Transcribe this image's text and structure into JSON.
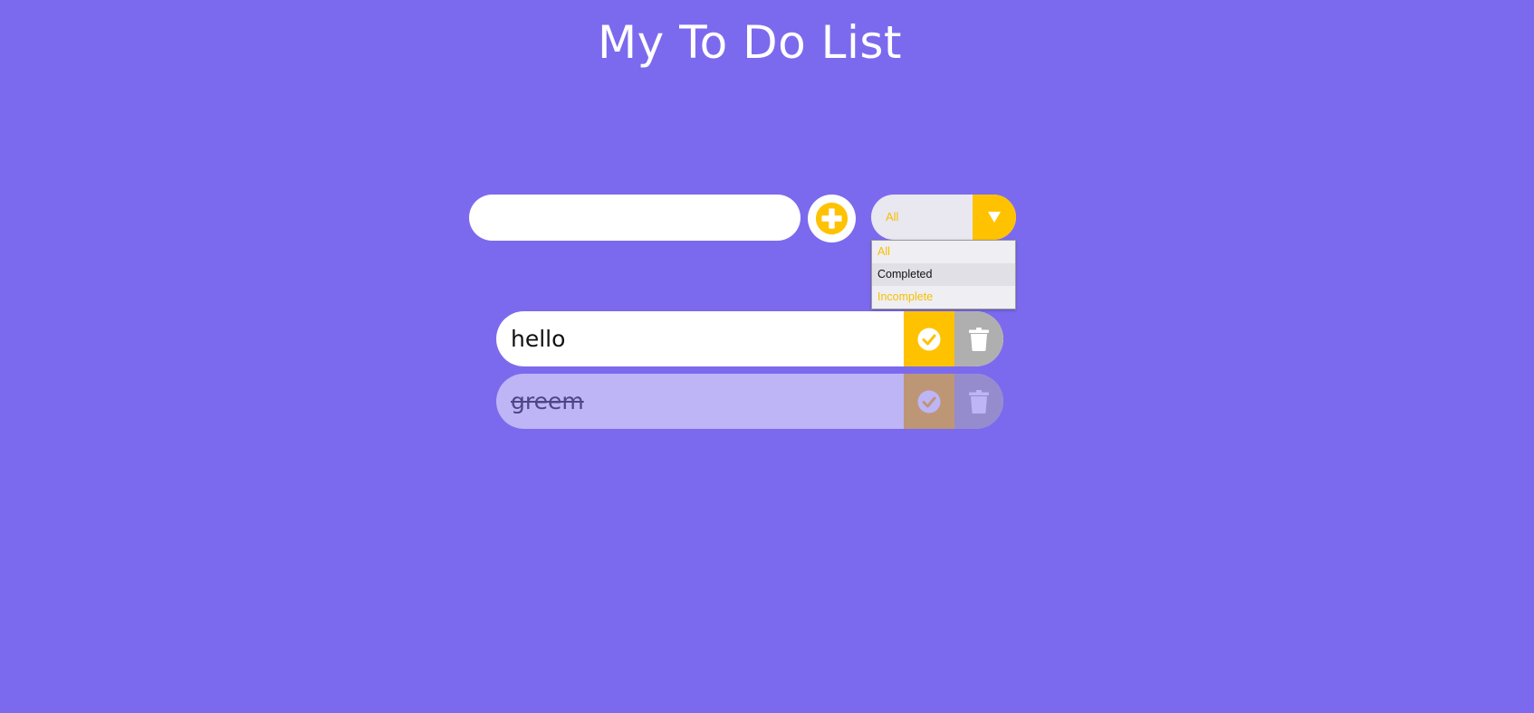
{
  "app": {
    "title": "My To Do List"
  },
  "form": {
    "input_value": "",
    "input_placeholder": ""
  },
  "filter": {
    "selected": "All",
    "options": [
      "All",
      "Completed",
      "Incomplete"
    ],
    "highlighted_option": "Completed"
  },
  "todos": [
    {
      "text": "hello",
      "completed": false
    },
    {
      "text": "greem",
      "completed": true
    }
  ],
  "icons": {
    "add": "plus-circle-icon",
    "dropdown": "caret-down-icon",
    "complete": "check-circle-icon",
    "delete": "trash-icon"
  },
  "colors": {
    "background": "#7b6aee",
    "accent": "#ffc200",
    "trash": "#afafaf",
    "surface": "#ffffff"
  }
}
